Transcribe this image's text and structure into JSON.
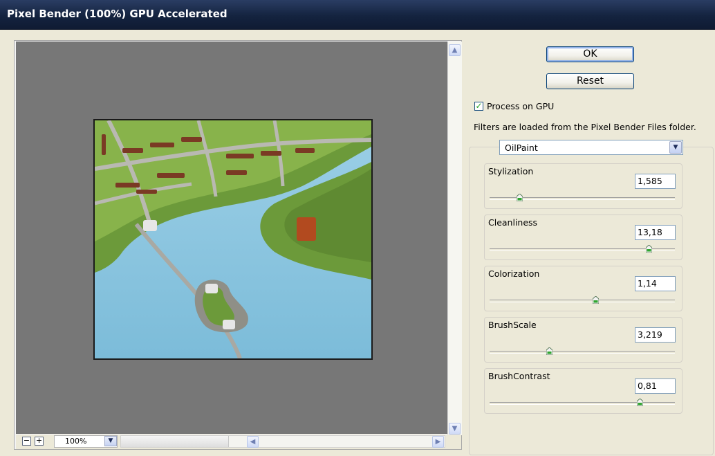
{
  "window": {
    "title": "Pixel Bender (100%) GPU Accelerated"
  },
  "buttons": {
    "ok": "OK",
    "reset": "Reset"
  },
  "process_gpu": {
    "label": "Process on GPU",
    "checked": true
  },
  "info_text": "Filters are loaded from the Pixel Bender Files folder.",
  "filter": {
    "selected": "OilPaint"
  },
  "params": [
    {
      "name": "Stylization",
      "value": "1,585",
      "slider_fraction": 0.16
    },
    {
      "name": "Cleanliness",
      "value": "13,18",
      "slider_fraction": 0.86
    },
    {
      "name": "Colorization",
      "value": "1,14",
      "slider_fraction": 0.57
    },
    {
      "name": "BrushScale",
      "value": "3,219",
      "slider_fraction": 0.32
    },
    {
      "name": "BrushContrast",
      "value": "0,81",
      "slider_fraction": 0.81
    }
  ],
  "zoom": {
    "value": "100%",
    "minus_icon": "zoom-out-icon",
    "plus_icon": "zoom-in-icon"
  },
  "colors": {
    "canvas": "#777777",
    "titlebar": "#14233f",
    "water": "#8ac2dd",
    "land": "#6c9a3a",
    "roof": "#7a3a24"
  }
}
